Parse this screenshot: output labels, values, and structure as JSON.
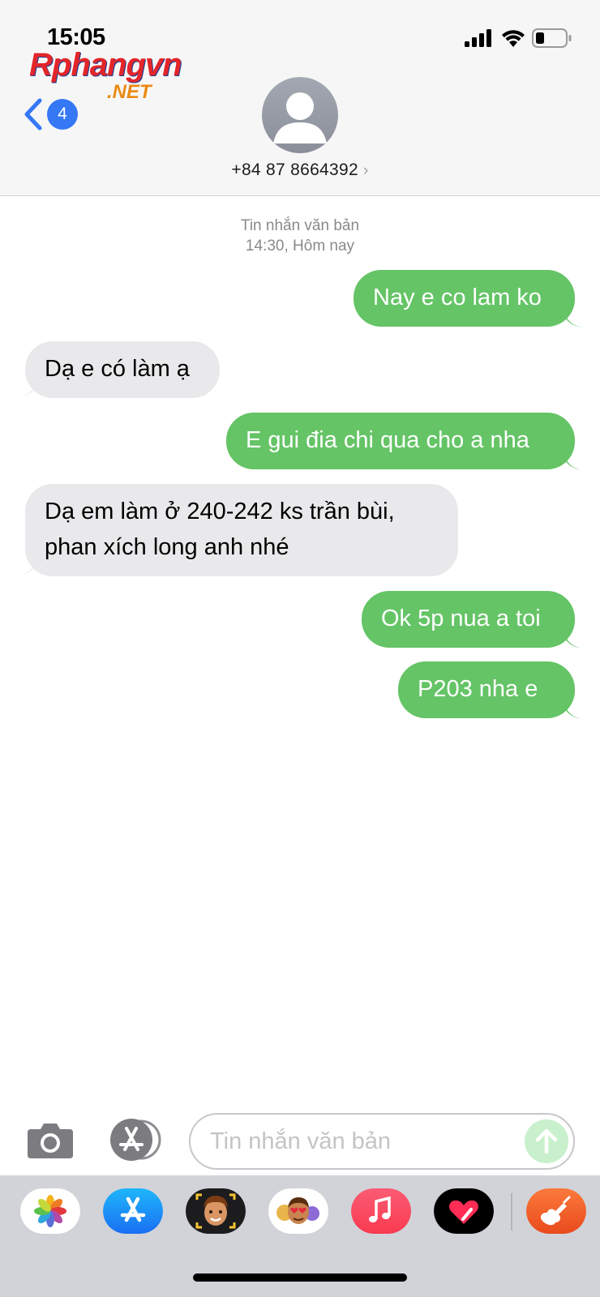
{
  "status_bar": {
    "time": "15:05"
  },
  "watermark": {
    "main": "Rphangvn",
    "sub": ".NET"
  },
  "header": {
    "back_count": "4",
    "contact_number": "+84 87 8664392",
    "contact_chevron": "›"
  },
  "conversation": {
    "timestamp_line1": "Tin nhắn văn bản",
    "timestamp_line2": "14:30, Hôm nay",
    "messages": [
      {
        "direction": "outgoing",
        "text": "Nay e co lam ko"
      },
      {
        "direction": "incoming",
        "text": "Dạ e có làm ạ"
      },
      {
        "direction": "outgoing",
        "text": "E gui đia chi qua cho a nha"
      },
      {
        "direction": "incoming",
        "line1": "Dạ em làm ở 240-242 ks trần bùi,",
        "line2": "phan xích long anh nhé"
      },
      {
        "direction": "outgoing",
        "text": "Ok 5p nua a toi"
      },
      {
        "direction": "outgoing",
        "text": "P203 nha e"
      }
    ]
  },
  "composer": {
    "placeholder": "Tin nhắn văn bản"
  },
  "icons": {
    "back": "chevron-left-icon",
    "avatar": "person-silhouette-icon",
    "camera": "camera-icon",
    "apps": "app-store-icon",
    "send": "arrow-up-icon"
  },
  "drawer_apps": [
    "Photos",
    "App Store",
    "Memoji",
    "Animoji",
    "Music",
    "Digital Touch",
    "GarageBand"
  ],
  "colors": {
    "outgoing_bubble": "#65c466",
    "incoming_bubble": "#e9e9eb",
    "accent": "#3478f6"
  }
}
